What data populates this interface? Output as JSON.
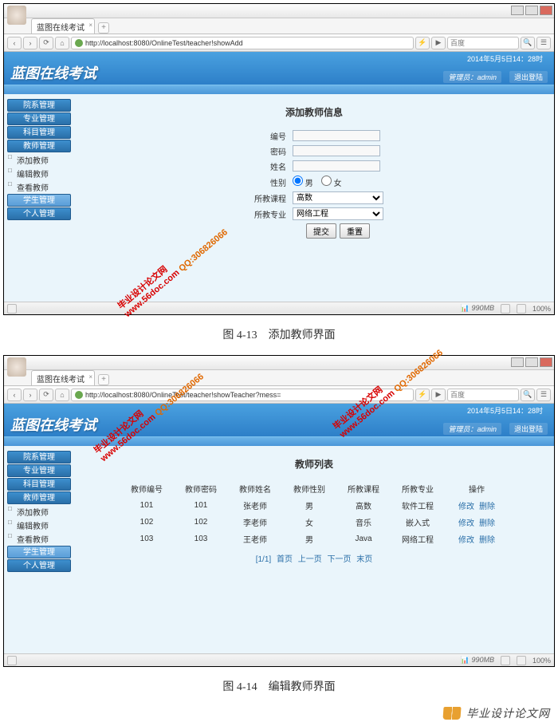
{
  "browser": {
    "tab_title_1": "蓝图在线考试",
    "tab_title_2": "蓝图在线考试",
    "url_1": "http://localhost:8080/OnlineTest/teacher!showAdd",
    "url_2": "http://localhost:8080/OnlineTest/teacher!showTeacher?mess=",
    "search_hint": "百度",
    "zoom": "100%"
  },
  "app": {
    "title": "蓝图在线考试",
    "datetime": "2014年5月5日14：28时",
    "admin_label": "管理员：",
    "admin_name": "admin",
    "logout": "退出登陆"
  },
  "sidebar": {
    "m1": "院系管理",
    "m2": "专业管理",
    "m3": "科目管理",
    "m4": "教师管理",
    "s1": "添加教师",
    "s2": "编辑教师",
    "s3": "查看教师",
    "m5": "学生管理",
    "m6": "个人管理"
  },
  "add_form": {
    "title": "添加教师信息",
    "id": "编号",
    "pwd": "密码",
    "name": "姓名",
    "sex": "性别",
    "male": "男",
    "female": "女",
    "course": "所教课程",
    "course_v": "高数",
    "major": "所教专业",
    "major_v": "网络工程",
    "submit": "提交",
    "reset": "重置"
  },
  "list": {
    "title": "教师列表",
    "h_id": "教师编号",
    "h_pwd": "教师密码",
    "h_name": "教师姓名",
    "h_sex": "教师性别",
    "h_course": "所教课程",
    "h_major": "所教专业",
    "h_ops": "操作",
    "rows": [
      {
        "id": "101",
        "pwd": "101",
        "name": "张老师",
        "sex": "男",
        "course": "高数",
        "major": "软件工程"
      },
      {
        "id": "102",
        "pwd": "102",
        "name": "李老师",
        "sex": "女",
        "course": "音乐",
        "major": "嵌入式"
      },
      {
        "id": "103",
        "pwd": "103",
        "name": "王老师",
        "sex": "男",
        "course": "Java",
        "major": "网络工程"
      }
    ],
    "edit": "修改",
    "del": "删除",
    "pager_info": "[1/1]",
    "first": "首页",
    "prev": "上一页",
    "next": "下一页",
    "last": "末页"
  },
  "status": {
    "disk": "990MB"
  },
  "captions": {
    "c1": "图 4-13　添加教师界面",
    "c2": "图 4-14　编辑教师界面"
  },
  "watermark": {
    "line1": "毕业设计论文网",
    "line2": "www.56doc.com",
    "line3": "QQ:306826066"
  },
  "footer": {
    "text": "毕业设计论文网"
  }
}
